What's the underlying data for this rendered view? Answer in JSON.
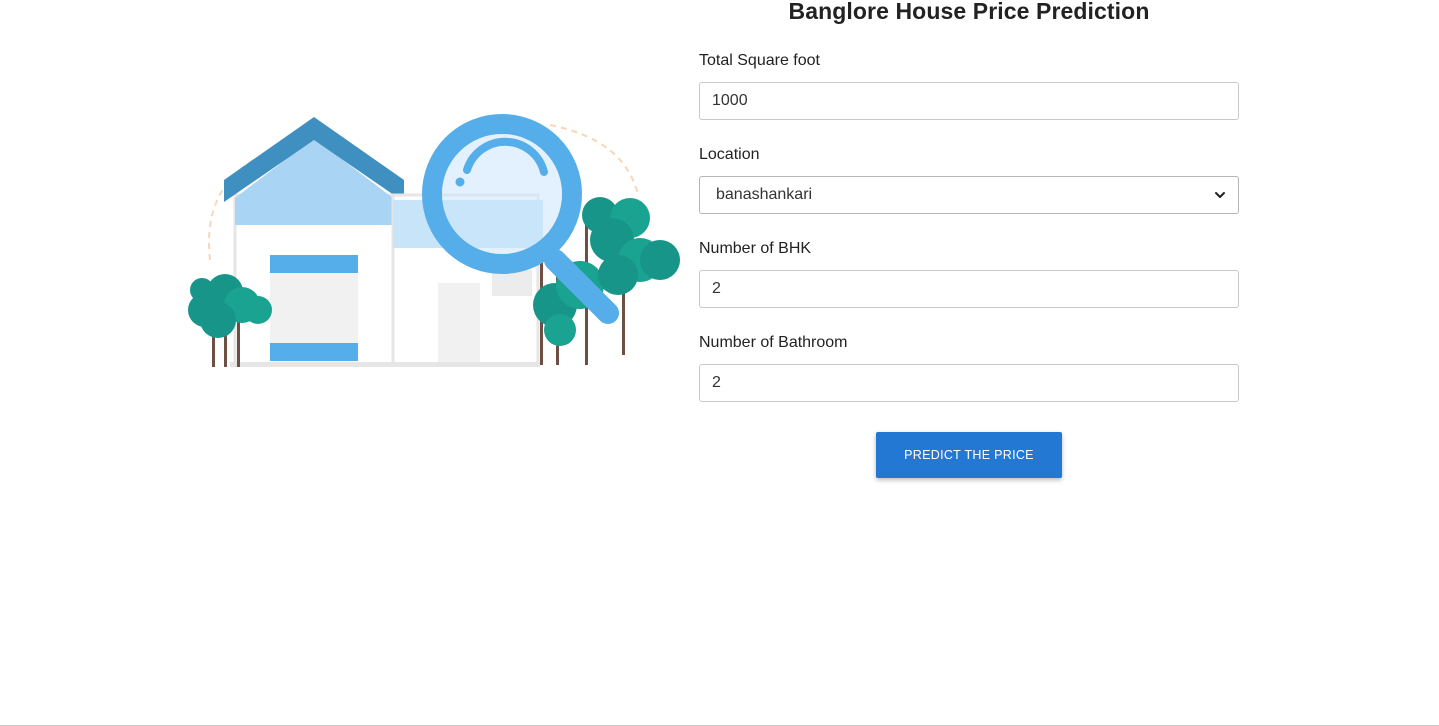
{
  "page": {
    "title": "Banglore House Price Prediction"
  },
  "illustration": {
    "name": "house-search-illustration"
  },
  "form": {
    "sqft": {
      "label": "Total Square foot",
      "value": "1000"
    },
    "location": {
      "label": "Location",
      "selected": "banashankari"
    },
    "bhk": {
      "label": "Number of BHK",
      "value": "2"
    },
    "bath": {
      "label": "Number of Bathroom",
      "value": "2"
    },
    "submit_label": "PREDICT THE PRICE"
  },
  "colors": {
    "accent": "#2378d3",
    "roof": "#3f8fc0",
    "window_blue": "#55aee9",
    "tree": "#179588",
    "trunk": "#6d4f44"
  }
}
